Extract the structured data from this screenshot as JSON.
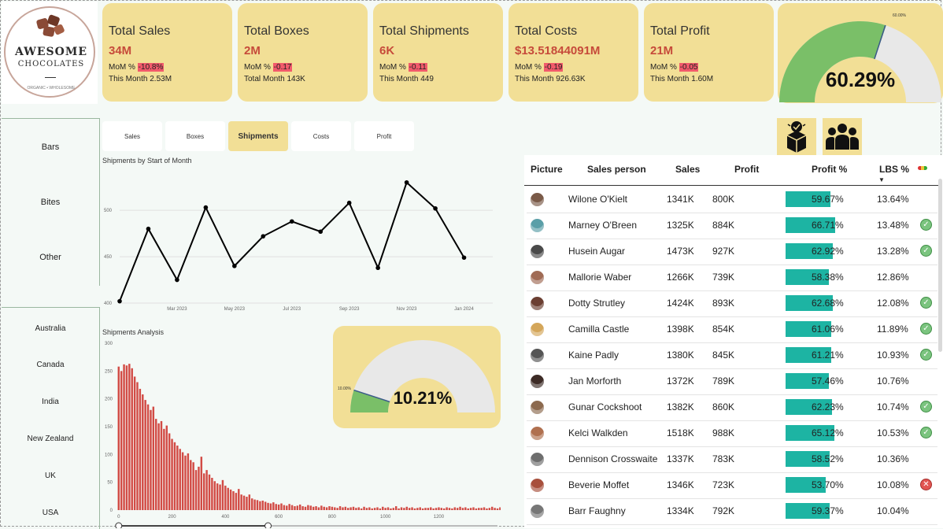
{
  "logo": {
    "word1": "AWESOME",
    "word2": "CHOCOLATES",
    "tagline": "ORGANIC • WHOLESOME"
  },
  "kpis": [
    {
      "title": "Total Sales",
      "value": "34M",
      "mom_label": "MoM % ",
      "mom": "-10.8%",
      "month": "This Month 2.53M"
    },
    {
      "title": "Total Boxes",
      "value": "2M",
      "mom_label": "MoM % ",
      "mom": "-0.17",
      "month": "Total Month 143K"
    },
    {
      "title": "Total Shipments",
      "value": "6K",
      "mom_label": "MoM % ",
      "mom": "-0.11",
      "month": "This Month 449"
    },
    {
      "title": "Total Costs",
      "value": "$13.51844091M",
      "mom_label": "MoM % ",
      "mom": "-0.19",
      "month": "This Month 926.63K"
    },
    {
      "title": "Total Profit",
      "value": "21M",
      "mom_label": "MoM % ",
      "mom": "-0.05",
      "month": "This Month 1.60M"
    }
  ],
  "gauge_top": {
    "value": "60.29%",
    "target_label": "60.00%",
    "fraction": 0.6029,
    "target": 0.6
  },
  "slicer_category": [
    "Bars",
    "Bites",
    "Other"
  ],
  "slicer_country": [
    "Australia",
    "Canada",
    "India",
    "New Zealand",
    "UK",
    "USA"
  ],
  "tabs": [
    "Sales",
    "Boxes",
    "Shipments",
    "Costs",
    "Profit"
  ],
  "line_title": "Shipments by Start of Month",
  "hist_title": "Shipments Analysis",
  "gauge_mid": {
    "value": "10.21%",
    "target_label": "10.00%",
    "fraction": 0.1021,
    "target": 0.1
  },
  "table": {
    "headers": [
      "Picture",
      "Sales person",
      "Sales",
      "Profit",
      "Profit %",
      "LBS %"
    ],
    "rows": [
      {
        "name": "Wilone O'Kielt",
        "sales": "1341K",
        "profit": "800K",
        "profit_pct": "59.67%",
        "lbs": "13.64%",
        "status": "",
        "avatar": "#7a5a48"
      },
      {
        "name": "Marney O'Breen",
        "sales": "1325K",
        "profit": "884K",
        "profit_pct": "66.71%",
        "lbs": "13.48%",
        "status": "ok",
        "avatar": "#5b9fa8"
      },
      {
        "name": "Husein Augar",
        "sales": "1473K",
        "profit": "927K",
        "profit_pct": "62.92%",
        "lbs": "13.28%",
        "status": "ok",
        "avatar": "#4a4a4a"
      },
      {
        "name": "Mallorie Waber",
        "sales": "1266K",
        "profit": "739K",
        "profit_pct": "58.38%",
        "lbs": "12.86%",
        "status": "",
        "avatar": "#a06b55"
      },
      {
        "name": "Dotty Strutley",
        "sales": "1424K",
        "profit": "893K",
        "profit_pct": "62.68%",
        "lbs": "12.08%",
        "status": "ok",
        "avatar": "#6b3f32"
      },
      {
        "name": "Camilla Castle",
        "sales": "1398K",
        "profit": "854K",
        "profit_pct": "61.06%",
        "lbs": "11.89%",
        "status": "ok",
        "avatar": "#d4a65a"
      },
      {
        "name": "Kaine Padly",
        "sales": "1380K",
        "profit": "845K",
        "profit_pct": "61.21%",
        "lbs": "10.93%",
        "status": "ok",
        "avatar": "#555555"
      },
      {
        "name": "Jan Morforth",
        "sales": "1372K",
        "profit": "789K",
        "profit_pct": "57.46%",
        "lbs": "10.76%",
        "status": "",
        "avatar": "#3d2b26"
      },
      {
        "name": "Gunar Cockshoot",
        "sales": "1382K",
        "profit": "860K",
        "profit_pct": "62.23%",
        "lbs": "10.74%",
        "status": "ok",
        "avatar": "#8c6a4f"
      },
      {
        "name": "Kelci Walkden",
        "sales": "1518K",
        "profit": "988K",
        "profit_pct": "65.12%",
        "lbs": "10.53%",
        "status": "ok",
        "avatar": "#b0704f"
      },
      {
        "name": "Dennison Crosswaite",
        "sales": "1337K",
        "profit": "783K",
        "profit_pct": "58.52%",
        "lbs": "10.36%",
        "status": "",
        "avatar": "#6e6e6e"
      },
      {
        "name": "Beverie Moffet",
        "sales": "1346K",
        "profit": "723K",
        "profit_pct": "53.70%",
        "lbs": "10.08%",
        "status": "bad",
        "avatar": "#a8503d"
      },
      {
        "name": "Barr Faughny",
        "sales": "1334K",
        "profit": "792K",
        "profit_pct": "59.37%",
        "lbs": "10.04%",
        "status": "",
        "avatar": "#777777"
      }
    ]
  },
  "chart_data": [
    {
      "type": "line",
      "title": "Shipments by Start of Month",
      "x": [
        "2023-01",
        "2023-02",
        "2023-03",
        "2023-04",
        "2023-05",
        "2023-06",
        "2023-07",
        "2023-08",
        "2023-09",
        "2023-10",
        "2023-11",
        "2023-12",
        "2024-01",
        "2024-02"
      ],
      "x_tick_labels": [
        "Mar 2023",
        "May 2023",
        "Jul 2023",
        "Sep 2023",
        "Nov 2023",
        "Jan 2024"
      ],
      "values": [
        402,
        480,
        425,
        503,
        440,
        472,
        488,
        477,
        508,
        438,
        530,
        502,
        449,
        null
      ],
      "ylim": [
        400,
        540
      ],
      "y_ticks": [
        400,
        450,
        500
      ],
      "grid": true,
      "color": "#000000"
    },
    {
      "type": "bar",
      "title": "Shipments Analysis",
      "x_ticks": [
        0,
        200,
        400,
        600,
        800,
        1000,
        1200
      ],
      "y_ticks": [
        0,
        50,
        100,
        150,
        200,
        250,
        300
      ],
      "xlim": [
        -20,
        1420
      ],
      "ylim": [
        0,
        300
      ],
      "bin_width": 10,
      "bin_start": 0,
      "values": [
        258,
        250,
        262,
        260,
        263,
        255,
        240,
        230,
        218,
        208,
        198,
        190,
        180,
        186,
        164,
        156,
        160,
        146,
        152,
        138,
        128,
        122,
        116,
        110,
        104,
        98,
        102,
        90,
        86,
        72,
        78,
        96,
        66,
        72,
        64,
        58,
        52,
        48,
        46,
        54,
        44,
        40,
        37,
        34,
        31,
        38,
        28,
        26,
        24,
        28,
        21,
        19,
        18,
        16,
        17,
        15,
        13,
        12,
        14,
        11,
        10,
        12,
        9,
        8,
        11,
        9,
        7,
        8,
        10,
        7,
        6,
        9,
        8,
        6,
        7,
        5,
        8,
        6,
        5,
        7,
        6,
        5,
        4,
        7,
        5,
        6,
        4,
        5,
        6,
        4,
        5,
        3,
        6,
        4,
        5,
        3,
        4,
        5,
        3,
        6,
        4,
        5,
        3,
        4,
        7,
        3,
        5,
        4,
        6,
        4,
        5,
        3,
        4,
        5,
        3,
        4,
        4,
        5,
        3,
        4,
        5,
        4,
        3,
        5,
        4,
        3,
        5,
        4,
        6,
        4,
        5,
        3,
        4,
        5,
        3,
        4,
        4,
        5,
        3,
        4,
        6,
        4,
        3,
        5
      ],
      "color": "#d24b45"
    }
  ],
  "colors": {
    "kpi_bg": "#f2df96",
    "accent_red": "#c64a3a",
    "teal": "#1db4a3",
    "gauge_green": "#7abf68"
  }
}
